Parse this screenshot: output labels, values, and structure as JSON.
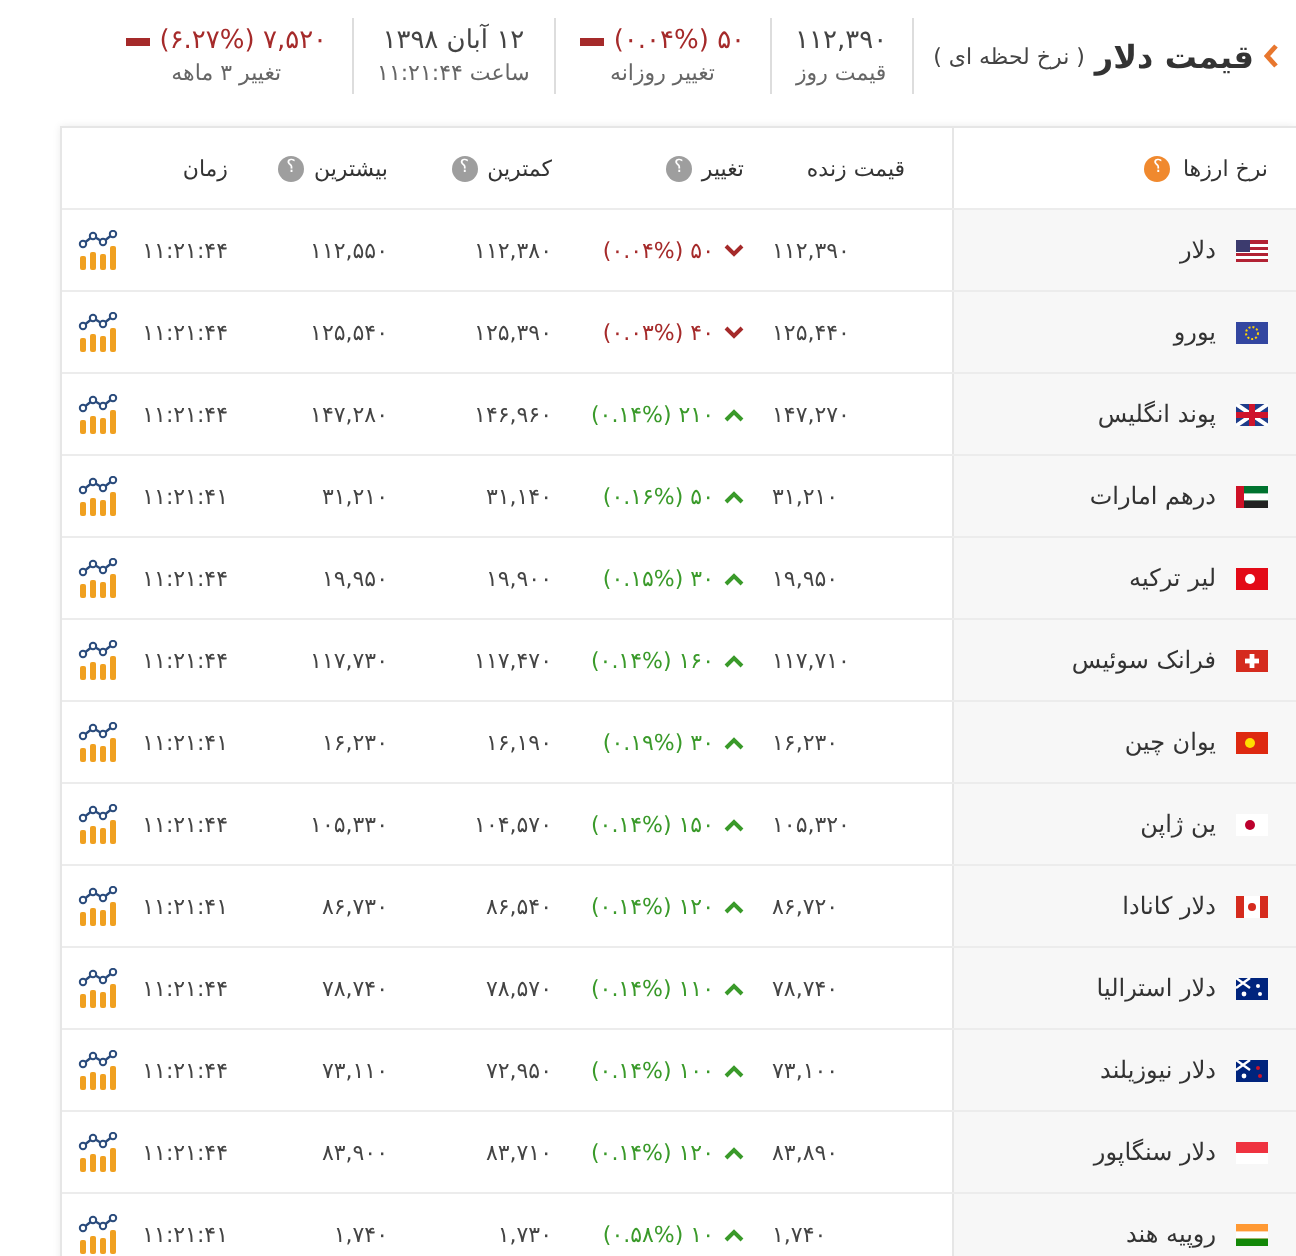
{
  "header": {
    "title": "قیمت دلار",
    "subtitle": "( نرخ لحظه ای )",
    "stats": [
      {
        "kind": "plain",
        "value": "۱۱۲,۳۹۰",
        "label": "قیمت روز"
      },
      {
        "kind": "change",
        "up": false,
        "value": "۵۰ (۰.۰۴%)",
        "label": "تغییر روزانه"
      },
      {
        "kind": "plain",
        "value": "۱۲ آبان ۱۳۹۸",
        "label": "ساعت ۱۱:۲۱:۴۴"
      },
      {
        "kind": "change",
        "up": false,
        "value": "۷,۵۲۰ (۶.۲۷%)",
        "label": "تغییر ۳ ماهه"
      }
    ]
  },
  "table": {
    "columns": [
      {
        "label": "نرخ ارزها",
        "help": "؟",
        "color": "#f0892e"
      },
      {
        "label": "قیمت زنده"
      },
      {
        "label": "تغییر",
        "help": "؟",
        "color": "#9e9e9e"
      },
      {
        "label": "کمترین",
        "help": "؟",
        "color": "#9e9e9e"
      },
      {
        "label": "بیشترین",
        "help": "؟",
        "color": "#9e9e9e"
      },
      {
        "label": "زمان"
      }
    ],
    "rows": [
      {
        "name": "دلار",
        "live": "۱۱۲,۳۹۰",
        "up": false,
        "change": "۵۰ (۰.۰۴%)",
        "low": "۱۱۲,۳۸۰",
        "high": "۱۱۲,۵۵۰",
        "time": "۱۱:۲۱:۴۴"
      },
      {
        "name": "یورو",
        "live": "۱۲۵,۴۴۰",
        "up": false,
        "change": "۴۰ (۰.۰۳%)",
        "low": "۱۲۵,۳۹۰",
        "high": "۱۲۵,۵۴۰",
        "time": "۱۱:۲۱:۴۴"
      },
      {
        "name": "پوند انگلیس",
        "live": "۱۴۷,۲۷۰",
        "up": true,
        "change": "۲۱۰ (۰.۱۴%)",
        "low": "۱۴۶,۹۶۰",
        "high": "۱۴۷,۲۸۰",
        "time": "۱۱:۲۱:۴۴"
      },
      {
        "name": "درهم امارات",
        "live": "۳۱,۲۱۰",
        "up": true,
        "change": "۵۰ (۰.۱۶%)",
        "low": "۳۱,۱۴۰",
        "high": "۳۱,۲۱۰",
        "time": "۱۱:۲۱:۴۱"
      },
      {
        "name": "لیر ترکیه",
        "live": "۱۹,۹۵۰",
        "up": true,
        "change": "۳۰ (۰.۱۵%)",
        "low": "۱۹,۹۰۰",
        "high": "۱۹,۹۵۰",
        "time": "۱۱:۲۱:۴۴"
      },
      {
        "name": "فرانک سوئیس",
        "live": "۱۱۷,۷۱۰",
        "up": true,
        "change": "۱۶۰ (۰.۱۴%)",
        "low": "۱۱۷,۴۷۰",
        "high": "۱۱۷,۷۳۰",
        "time": "۱۱:۲۱:۴۴"
      },
      {
        "name": "یوان چین",
        "live": "۱۶,۲۳۰",
        "up": true,
        "change": "۳۰ (۰.۱۹%)",
        "low": "۱۶,۱۹۰",
        "high": "۱۶,۲۳۰",
        "time": "۱۱:۲۱:۴۱"
      },
      {
        "name": "ین ژاپن",
        "live": "۱۰۵,۳۲۰",
        "up": true,
        "change": "۱۵۰ (۰.۱۴%)",
        "low": "۱۰۴,۵۷۰",
        "high": "۱۰۵,۳۳۰",
        "time": "۱۱:۲۱:۴۴"
      },
      {
        "name": "دلار کانادا",
        "live": "۸۶,۷۲۰",
        "up": true,
        "change": "۱۲۰ (۰.۱۴%)",
        "low": "۸۶,۵۴۰",
        "high": "۸۶,۷۳۰",
        "time": "۱۱:۲۱:۴۱"
      },
      {
        "name": "دلار استرالیا",
        "live": "۷۸,۷۴۰",
        "up": true,
        "change": "۱۱۰ (۰.۱۴%)",
        "low": "۷۸,۵۷۰",
        "high": "۷۸,۷۴۰",
        "time": "۱۱:۲۱:۴۴"
      },
      {
        "name": "دلار نیوزیلند",
        "live": "۷۳,۱۰۰",
        "up": true,
        "change": "۱۰۰ (۰.۱۴%)",
        "low": "۷۲,۹۵۰",
        "high": "۷۳,۱۱۰",
        "time": "۱۱:۲۱:۴۴"
      },
      {
        "name": "دلار سنگاپور",
        "live": "۸۳,۸۹۰",
        "up": true,
        "change": "۱۲۰ (۰.۱۴%)",
        "low": "۸۳,۷۱۰",
        "high": "۸۳,۹۰۰",
        "time": "۱۱:۲۱:۴۴"
      },
      {
        "name": "روپیه هند",
        "live": "۱,۷۴۰",
        "up": true,
        "change": "۱۰ (۰.۵۸%)",
        "low": "۱,۷۳۰",
        "high": "۱,۷۴۰",
        "time": "۱۱:۲۱:۴۱"
      }
    ]
  }
}
